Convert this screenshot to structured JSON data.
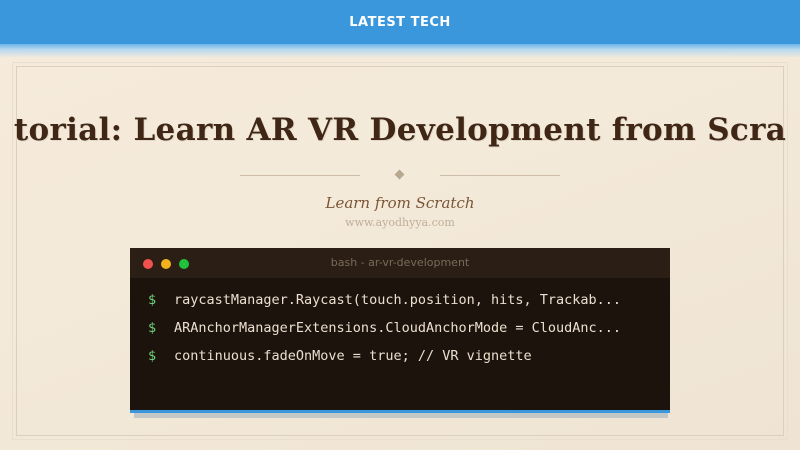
{
  "header": {
    "title": "LATEST TECH"
  },
  "hero": {
    "headline": "torial: Learn AR VR Development from Scra",
    "subtitle": "Learn from Scratch",
    "website": "www.ayodhyya.com"
  },
  "terminal": {
    "title": "bash - ar-vr-development",
    "prompt": "$",
    "lines": [
      "raycastManager.Raycast(touch.position, hits, Trackab...",
      "ARAnchorManagerExtensions.CloudAnchorMode = CloudAnc...",
      "continuous.fadeOnMove = true;  // VR vignette"
    ]
  },
  "colors": {
    "header_blue": "#3a97dc",
    "headline_brown": "#3f2615",
    "terminal_bg": "#1c130d",
    "prompt_green": "#6fd27a"
  }
}
